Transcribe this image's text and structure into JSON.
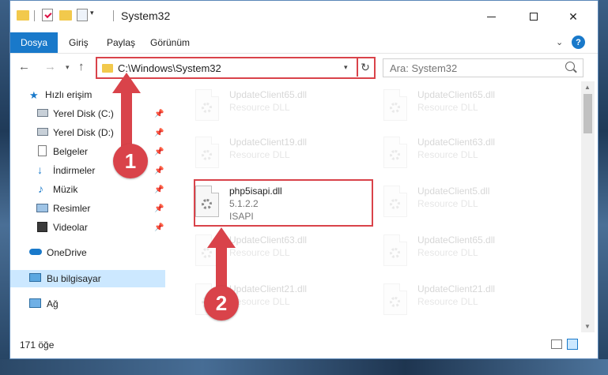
{
  "window": {
    "title": "System32",
    "accent": "#1979CA",
    "highlight": "#D9434A"
  },
  "ribbon": {
    "tabs": [
      "Dosya",
      "Giriş",
      "Paylaş",
      "Görünüm"
    ]
  },
  "address": {
    "path": "C:\\Windows\\System32",
    "search_placeholder": "Ara: System32"
  },
  "sidebar": {
    "items": [
      {
        "label": "Hızlı erişim",
        "icon": "star-icon"
      },
      {
        "label": "Yerel Disk (C:)",
        "icon": "drive-icon"
      },
      {
        "label": "Yerel Disk (D:)",
        "icon": "drive-icon"
      },
      {
        "label": "Belgeler",
        "icon": "document-icon"
      },
      {
        "label": "İndirmeler",
        "icon": "download-icon"
      },
      {
        "label": "Müzik",
        "icon": "music-icon"
      },
      {
        "label": "Resimler",
        "icon": "pictures-icon"
      },
      {
        "label": "Videolar",
        "icon": "video-icon"
      },
      {
        "label": "OneDrive",
        "icon": "cloud-icon"
      },
      {
        "label": "Bu bilgisayar",
        "icon": "computer-icon"
      },
      {
        "label": "Ağ",
        "icon": "network-icon"
      }
    ]
  },
  "files": [
    {
      "name": "UpdateClient65.dll",
      "type": "Resource DLL"
    },
    {
      "name": "UpdateClient65.dll",
      "type": "Resource DLL"
    },
    {
      "name": "UpdateClient19.dll",
      "type": "Resource DLL"
    },
    {
      "name": "UpdateClient63.dll",
      "type": "Resource DLL"
    },
    {
      "name": "php5isapi.dll",
      "version": "5.1.2.2",
      "type": "ISAPI"
    },
    {
      "name": "UpdateClient5.dll",
      "type": "Resource DLL"
    },
    {
      "name": "UpdateClient63.dll",
      "type": "Resource DLL"
    },
    {
      "name": "UpdateClient65.dll",
      "type": "Resource DLL"
    },
    {
      "name": "UpdateClient21.dll",
      "type": "Resource DLL"
    },
    {
      "name": "UpdateClient21.dll",
      "type": "Resource DLL"
    }
  ],
  "status": {
    "item_count": "171 öğe"
  },
  "callouts": [
    "1",
    "2"
  ]
}
